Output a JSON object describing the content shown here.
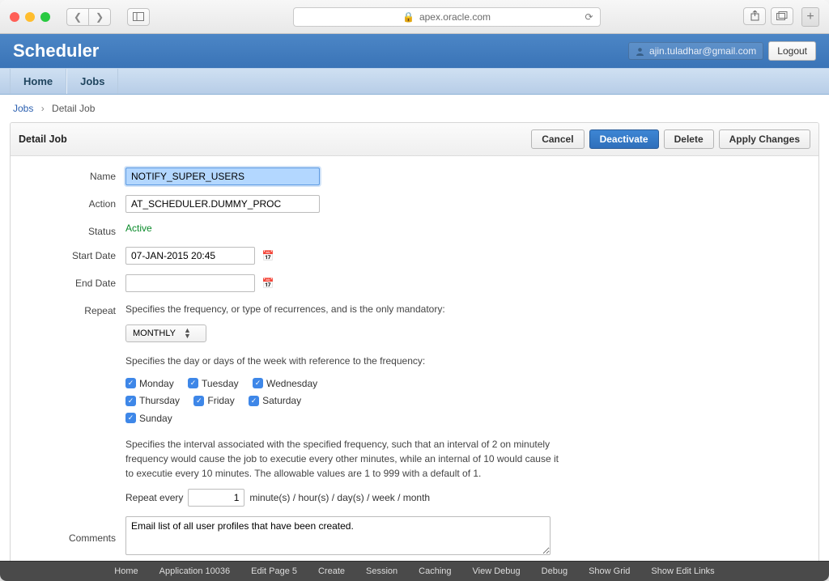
{
  "browser": {
    "address": "apex.oracle.com",
    "lock_icon": "lock-icon"
  },
  "app": {
    "title": "Scheduler",
    "user_email": "ajin.tuladhar@gmail.com",
    "logout_label": "Logout"
  },
  "nav": {
    "home": "Home",
    "jobs": "Jobs"
  },
  "breadcrumb": {
    "parent": "Jobs",
    "current": "Detail Job"
  },
  "region": {
    "title": "Detail Job",
    "buttons": {
      "cancel": "Cancel",
      "deactivate": "Deactivate",
      "delete": "Delete",
      "apply": "Apply Changes"
    }
  },
  "form": {
    "labels": {
      "name": "Name",
      "action": "Action",
      "status": "Status",
      "start_date": "Start Date",
      "end_date": "End Date",
      "repeat": "Repeat",
      "comments": "Comments"
    },
    "values": {
      "name": "NOTIFY_SUPER_USERS",
      "action": "AT_SCHEDULER.DUMMY_PROC",
      "status": "Active",
      "start_date": "07-JAN-2015 20:45",
      "end_date": "",
      "frequency_select": "MONTHLY",
      "interval": "1",
      "comments": "Email list of all user profiles that have been created."
    },
    "help": {
      "frequency": "Specifies the frequency, or type of recurrences, and is the only mandatory:",
      "days": "Specifies the day or days of the week with reference to the frequency:",
      "interval": "Specifies the interval associated with the specified frequency, such that an interval of 2 on minutely frequency would cause the job to executie every other minutes, while an internal of 10 would cause it to executie every 10 minutes. The allowable values are 1 to 999 with a default of 1."
    },
    "repeat_line_prefix": "Repeat every",
    "repeat_line_suffix": "minute(s) / hour(s) / day(s) / week / month",
    "days": {
      "monday": "Monday",
      "tuesday": "Tuesday",
      "wednesday": "Wednesday",
      "thursday": "Thursday",
      "friday": "Friday",
      "saturday": "Saturday",
      "sunday": "Sunday"
    }
  },
  "devbar": {
    "home": "Home",
    "application": "Application 10036",
    "edit_page": "Edit Page 5",
    "create": "Create",
    "session": "Session",
    "caching": "Caching",
    "view_debug": "View Debug",
    "debug": "Debug",
    "show_grid": "Show Grid",
    "show_edit_links": "Show Edit Links"
  }
}
